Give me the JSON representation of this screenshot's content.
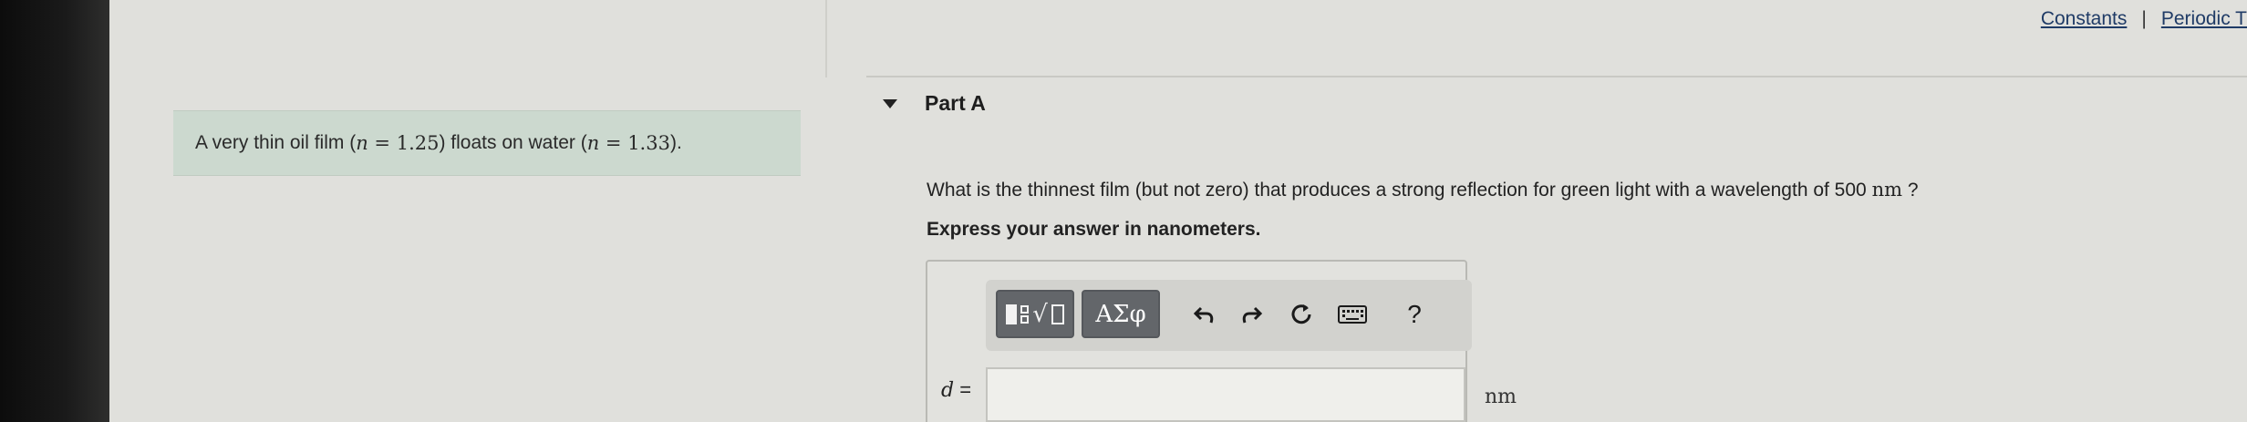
{
  "top_links": {
    "constants": "Constants",
    "separator": "|",
    "periodic": "Periodic T"
  },
  "problem": {
    "prefix": "A very thin oil film (",
    "n1_symbol": "n",
    "n1_eq": " = ",
    "n1_value": "1.25",
    "middle": ") floats on water (",
    "n2_symbol": "n",
    "n2_eq": " = ",
    "n2_value": "1.33",
    "suffix": ")."
  },
  "part": {
    "title": "Part A"
  },
  "question": {
    "text": "What is the thinnest film (but not zero) that produces a strong reflection for green light with a wavelength of 500",
    "unit": "nm",
    "end": "?"
  },
  "instruction": "Express your answer in nanometers.",
  "toolbar": {
    "symbols_label": "ΑΣφ",
    "help_label": "?"
  },
  "answer": {
    "variable": "d",
    "equals": " =",
    "value": "",
    "unit": "nm"
  }
}
